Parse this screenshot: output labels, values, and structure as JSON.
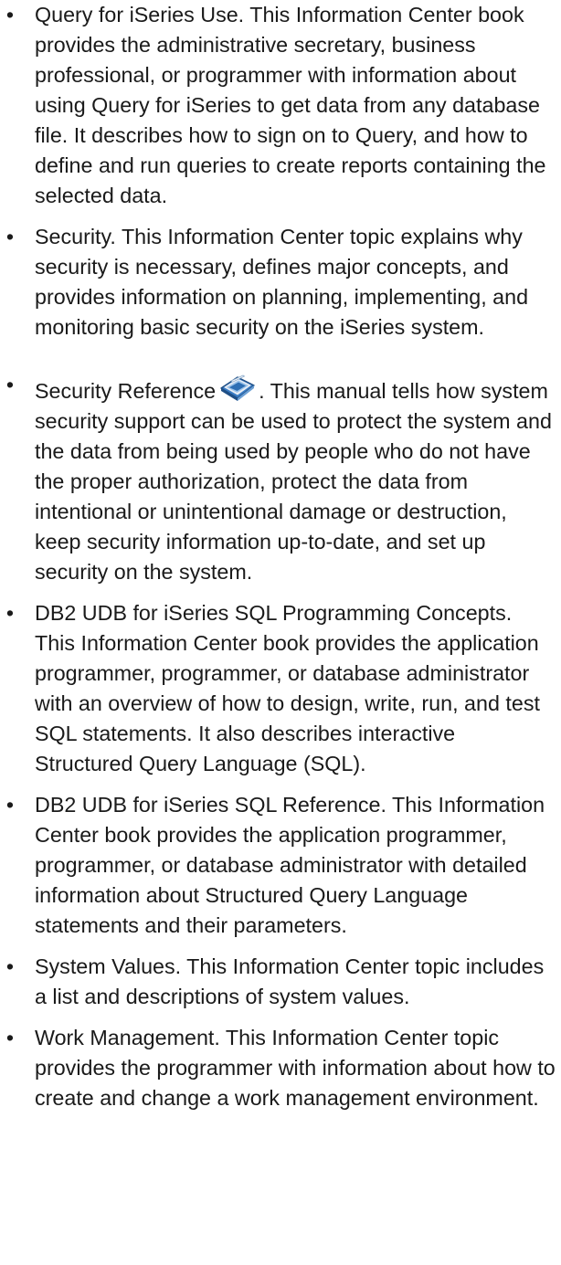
{
  "items": [
    {
      "text": "Query for iSeries Use. This Information Center book provides the administrative secretary, business professional, or programmer with information about using Query for iSeries to get data from any database file. It describes how to sign on to Query, and how to define and run queries to create reports containing the selected data."
    },
    {
      "text": "Security. This Information Center topic explains why security is necessary, defines major concepts, and provides information on planning, implementing, and monitoring basic security on the iSeries system."
    },
    {
      "title": "Security Reference",
      "icon": "book-icon",
      "text": ". This manual tells how system security support can be used to protect the system and the data from being used by people who do not have the proper authorization, protect the data from intentional or unintentional damage or destruction, keep security information up-to-date, and set up security on the system."
    },
    {
      "text": "DB2 UDB for iSeries SQL Programming Concepts. This Information Center book provides the application programmer, programmer, or database administrator with an overview of how to design, write, run, and test SQL statements. It also describes interactive Structured Query Language (SQL)."
    },
    {
      "text": "DB2 UDB for iSeries SQL Reference. This Information Center book provides the application programmer, programmer, or database administrator with detailed information about Structured Query Language statements and their parameters."
    },
    {
      "text": "System Values. This Information Center topic includes a list and descriptions of system values."
    },
    {
      "text": "Work Management. This Information Center topic provides the programmer with information about how to create and change a work management environment."
    }
  ],
  "bullet_char": "•",
  "colors": {
    "text": "#1a1a1a",
    "icon_cover": "#2f6fb4",
    "icon_pages": "#e9eef5"
  }
}
